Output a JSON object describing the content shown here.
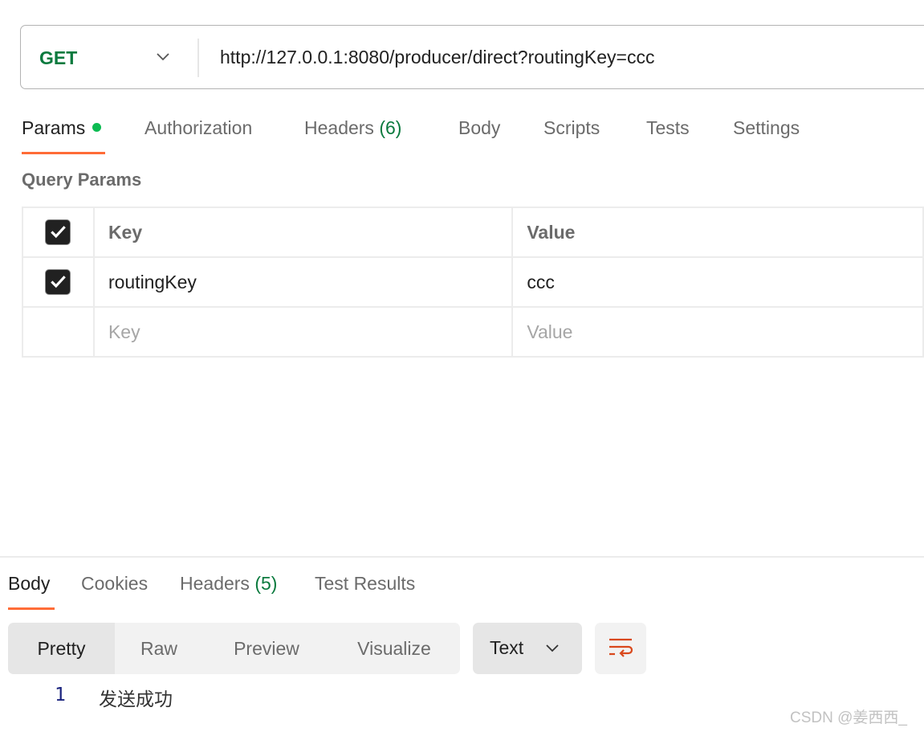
{
  "request": {
    "method": "GET",
    "url": "http://127.0.0.1:8080/producer/direct?routingKey=ccc"
  },
  "request_tabs": [
    {
      "label": "Params",
      "active": true,
      "indicator": "green-dot"
    },
    {
      "label": "Authorization"
    },
    {
      "label": "Headers",
      "count": "(6)"
    },
    {
      "label": "Body"
    },
    {
      "label": "Scripts"
    },
    {
      "label": "Tests"
    },
    {
      "label": "Settings"
    }
  ],
  "query_params": {
    "title": "Query Params",
    "headers": {
      "key": "Key",
      "value": "Value"
    },
    "rows": [
      {
        "checked": true,
        "key": "routingKey",
        "value": "ccc"
      }
    ],
    "placeholder": {
      "key": "Key",
      "value": "Value"
    }
  },
  "response_tabs": [
    {
      "label": "Body",
      "active": true
    },
    {
      "label": "Cookies"
    },
    {
      "label": "Headers",
      "count": "(5)"
    },
    {
      "label": "Test Results"
    }
  ],
  "view_modes": [
    "Pretty",
    "Raw",
    "Preview",
    "Visualize"
  ],
  "active_view": "Pretty",
  "format": "Text",
  "body_lines": [
    {
      "n": "1",
      "text": "发送成功"
    }
  ],
  "watermark": "CSDN @姜西西_",
  "colors": {
    "accent": "#ff6c37",
    "method": "#0b7a3e",
    "dot": "#0cbb52"
  }
}
